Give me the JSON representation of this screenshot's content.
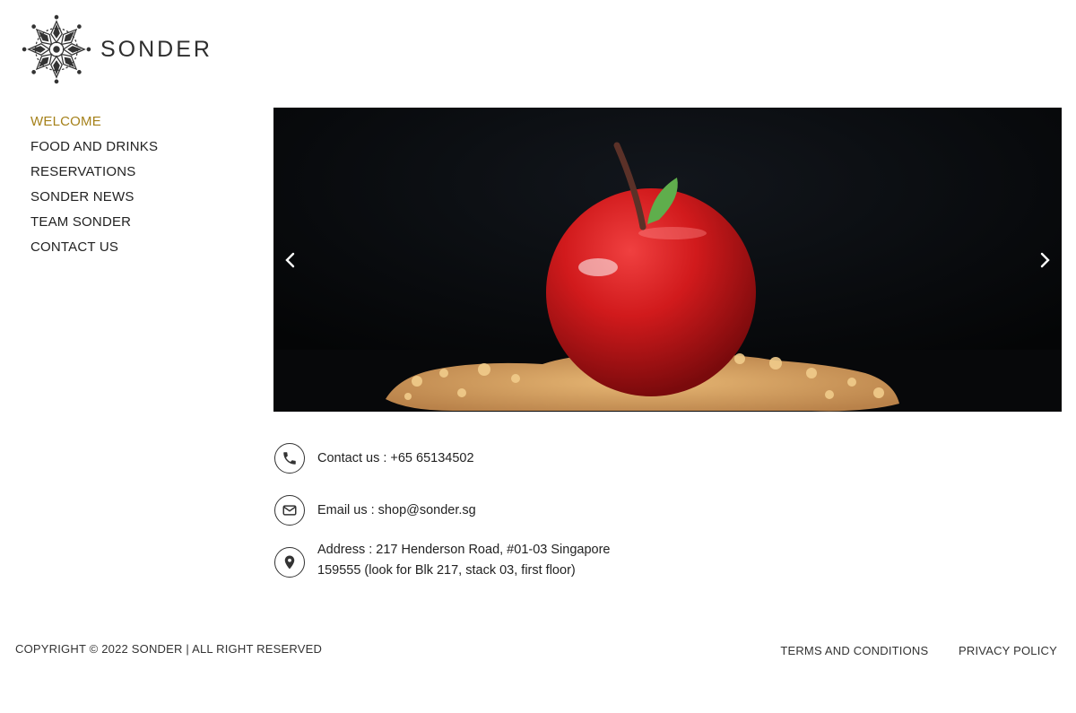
{
  "brand": {
    "name": "SONDER"
  },
  "nav": {
    "items": [
      {
        "label": "WELCOME",
        "active": true
      },
      {
        "label": "FOOD AND DRINKS"
      },
      {
        "label": "RESERVATIONS"
      },
      {
        "label": "SONDER NEWS"
      },
      {
        "label": "TEAM SONDER"
      },
      {
        "label": "CONTACT US"
      }
    ]
  },
  "slider": {
    "image": "red-apple-dessert-on-crumble",
    "prev_icon": "chevron-left-icon",
    "next_icon": "chevron-right-icon"
  },
  "contact": {
    "phone": {
      "icon": "phone-icon",
      "text": "Contact us : +65 65134502"
    },
    "email": {
      "icon": "mail-icon",
      "text": "Email us : shop@sonder.sg"
    },
    "address": {
      "icon": "map-pin-icon",
      "line1": "Address : 217 Henderson Road, #01-03 Singapore",
      "line2": "159555 (look for Blk 217, stack 03, first floor)"
    }
  },
  "footer": {
    "copyright": "COPYRIGHT © 2022 SONDER | ALL RIGHT RESERVED",
    "links": [
      "TERMS AND CONDITIONS",
      "PRIVACY POLICY"
    ]
  },
  "colors": {
    "accent": "#a5811a",
    "text": "#222222",
    "hero_bg": "#050608"
  }
}
